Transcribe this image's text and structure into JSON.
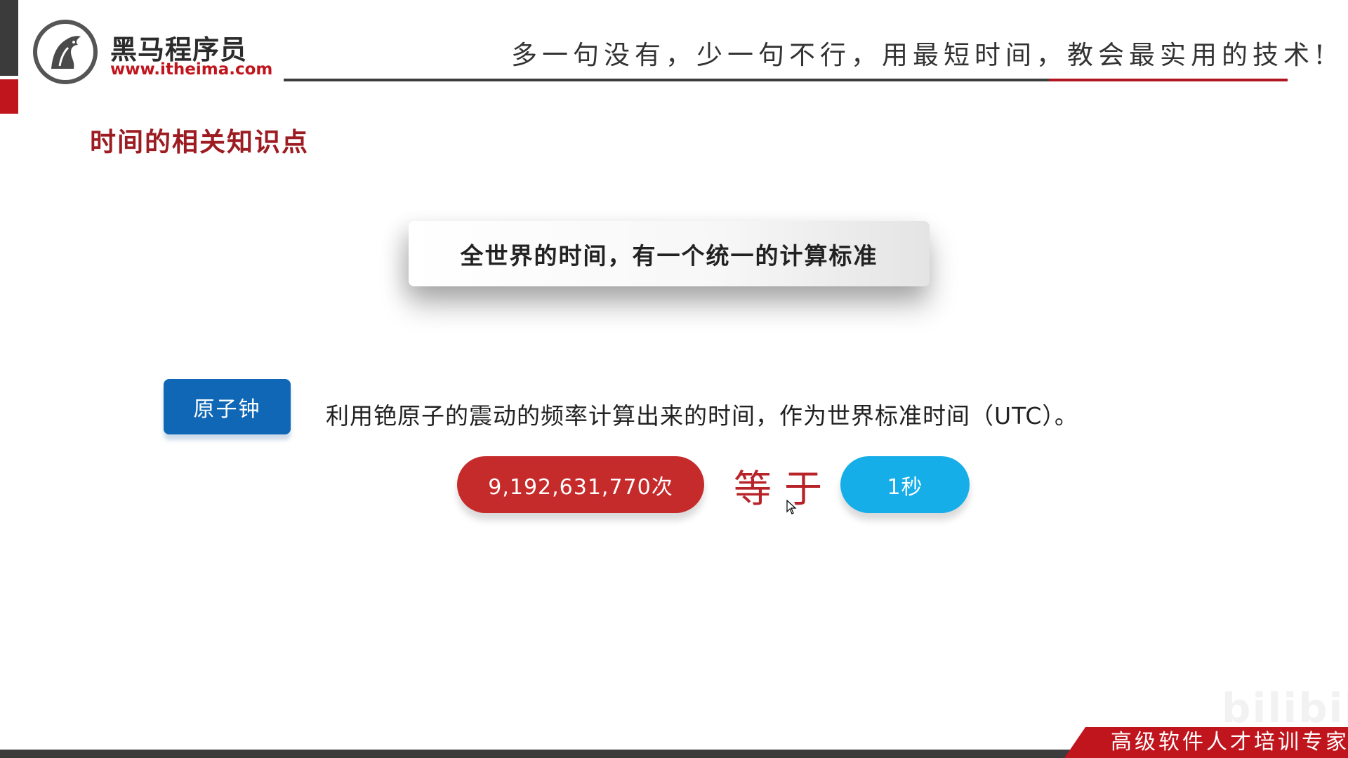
{
  "header": {
    "logo_name": "黑马程序员",
    "logo_url": "www.itheima.com",
    "slogan": "多一句没有，少一句不行，用最短时间，教会最实用的技术!"
  },
  "slide": {
    "section_title": "时间的相关知识点",
    "standard_text": "全世界的时间，有一个统一的计算标准",
    "atomic_clock_label": "原子钟",
    "description": "利用铯原子的震动的频率计算出来的时间，作为世界标准时间（UTC）。",
    "count_label": "9,192,631,770次",
    "equals_label": "等于",
    "second_label": "1秒"
  },
  "footer": {
    "tagline": "高级软件人才培训专家",
    "watermark": "bilibili"
  },
  "colors": {
    "brand_red": "#c0151d",
    "title_red": "#9c1c22",
    "atomic_blue": "#0f67b6",
    "count_red": "#c62b2b",
    "second_blue": "#16aee8",
    "dark_gray": "#3b3b3b"
  },
  "icons": {
    "logo": "horse-head-logo-icon",
    "cursor": "mouse-pointer-icon"
  }
}
